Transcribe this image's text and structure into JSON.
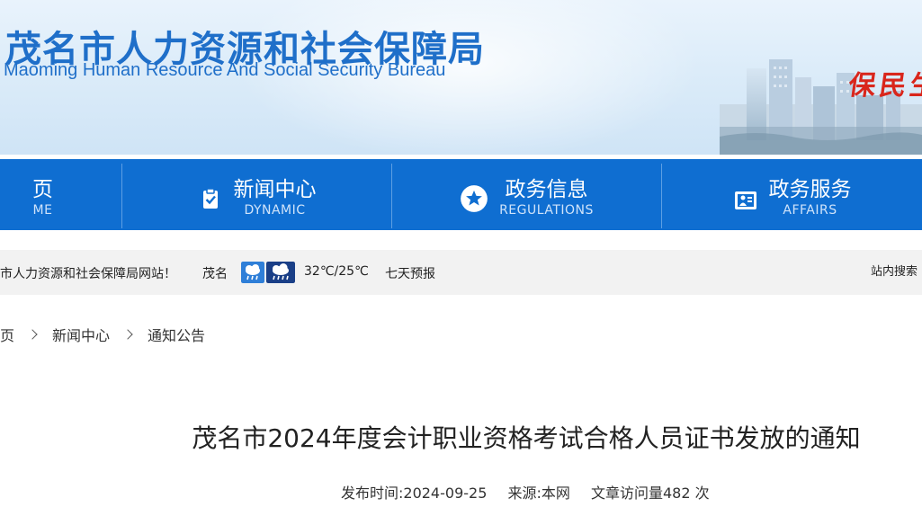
{
  "header": {
    "title_cn": "茂名市人力资源和社会保障局",
    "title_en": "Maoming Human Resource And Social Security Bureau",
    "slogan": "保民生"
  },
  "nav": {
    "items": [
      {
        "cn": "页",
        "en": "ME",
        "icon": "home-icon"
      },
      {
        "cn": "新闻中心",
        "en": "DYNAMIC",
        "icon": "clipboard-check-icon"
      },
      {
        "cn": "政务信息",
        "en": "REGULATIONS",
        "icon": "star-icon"
      },
      {
        "cn": "政务服务",
        "en": "AFFAIRS",
        "icon": "service-icon"
      }
    ]
  },
  "infobar": {
    "welcome": "市人力资源和社会保障局网站！",
    "city": "茂名",
    "weather_icons": [
      "sleet-icon",
      "rain-icon"
    ],
    "temperature": "32℃/25℃",
    "forecast": "七天预报",
    "search_label": "站内搜索"
  },
  "breadcrumb": {
    "items": [
      "首页",
      "新闻中心",
      "通知公告"
    ]
  },
  "article": {
    "title": "茂名市2024年度会计职业资格考试合格人员证书发放的通知",
    "publish_time": "发布时间:2024-09-25",
    "source": "来源:本网",
    "views": "文章访问量482 次"
  },
  "colors": {
    "brand_blue": "#0f6ed1",
    "title_blue": "#1f6fc9",
    "slogan_red": "#d9261c",
    "infobar_bg": "#f2f2f2"
  }
}
